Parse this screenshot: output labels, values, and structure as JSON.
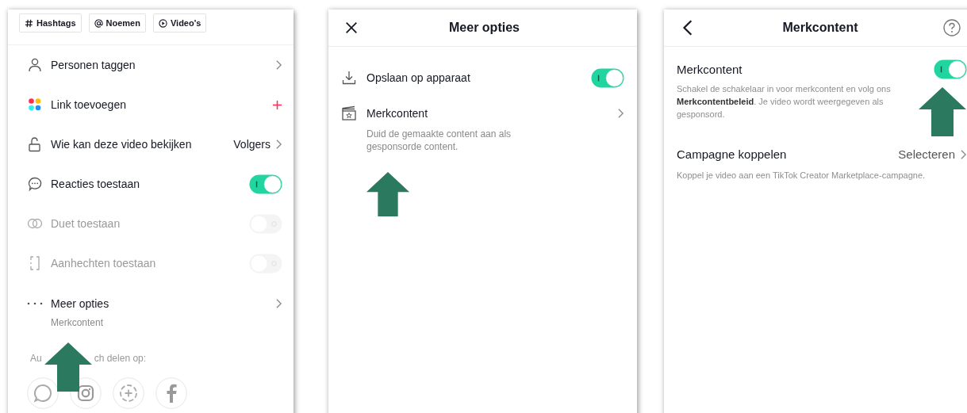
{
  "panels": [
    {
      "kind": "post_settings",
      "chips": [
        {
          "label": "Hashtags"
        },
        {
          "label": "Noemen"
        },
        {
          "label": "Video's"
        }
      ],
      "items": [
        {
          "kind": "nav",
          "label": "Personen taggen",
          "disabled": false
        },
        {
          "kind": "add",
          "label": "Link toevoegen",
          "disabled": false
        },
        {
          "kind": "nav",
          "label": "Wie kan deze video bekijken",
          "value": "Volgers",
          "disabled": false
        },
        {
          "kind": "toggle",
          "label": "Reacties toestaan",
          "on": true,
          "disabled": false
        },
        {
          "kind": "toggle",
          "label": "Duet toestaan",
          "on": false,
          "disabled": true
        },
        {
          "kind": "toggle",
          "label": "Aanhechten toestaan",
          "on": false,
          "disabled": true
        },
        {
          "kind": "nav",
          "label": "Meer opties",
          "sublabel": "Merkcontent",
          "disabled": false
        }
      ],
      "share": {
        "label_parts": [
          "Au",
          "ch delen op:"
        ]
      }
    },
    {
      "kind": "more_options",
      "title": "Meer opties",
      "items": [
        {
          "kind": "toggle",
          "label": "Opslaan op apparaat",
          "on": true,
          "disabled": false
        },
        {
          "kind": "nav",
          "label": "Merkcontent",
          "sublabel": "Duid de gemaakte content aan als gesponsorde content.",
          "disabled": false
        }
      ]
    },
    {
      "kind": "branded_content",
      "title": "Merkcontent",
      "items": [
        {
          "kind": "toggle",
          "label": "Merkcontent",
          "on": true,
          "disabled": false,
          "description": "Schakel de schakelaar in voor merkcontent en volg ons **Merkcontentbeleid**. Je video wordt weergegeven als gesponsord."
        },
        {
          "kind": "nav",
          "label": "Campagne koppelen",
          "value": "Selecteren",
          "disabled": false,
          "description": "Koppel je video aan een TikTok Creator Marketplace-campagne."
        }
      ]
    }
  ]
}
